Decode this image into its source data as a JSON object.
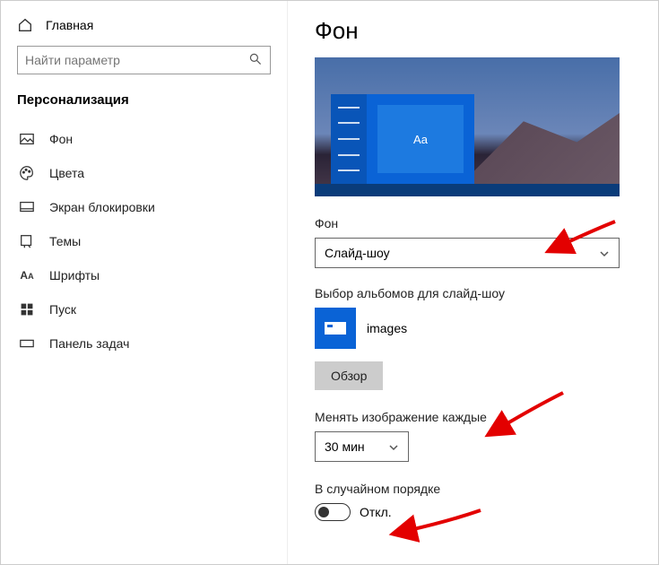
{
  "sidebar": {
    "home": "Главная",
    "search_placeholder": "Найти параметр",
    "section": "Персонализация",
    "items": [
      {
        "label": "Фон"
      },
      {
        "label": "Цвета"
      },
      {
        "label": "Экран блокировки"
      },
      {
        "label": "Темы"
      },
      {
        "label": "Шрифты"
      },
      {
        "label": "Пуск"
      },
      {
        "label": "Панель задач"
      }
    ]
  },
  "main": {
    "title": "Фон",
    "preview_tile": "Aa",
    "bg_label": "Фон",
    "bg_value": "Слайд-шоу",
    "album_label": "Выбор альбомов для слайд-шоу",
    "album_name": "images",
    "browse": "Обзор",
    "interval_label": "Менять изображение каждые",
    "interval_value": "30 мин",
    "shuffle_label": "В случайном порядке",
    "shuffle_state": "Откл."
  }
}
